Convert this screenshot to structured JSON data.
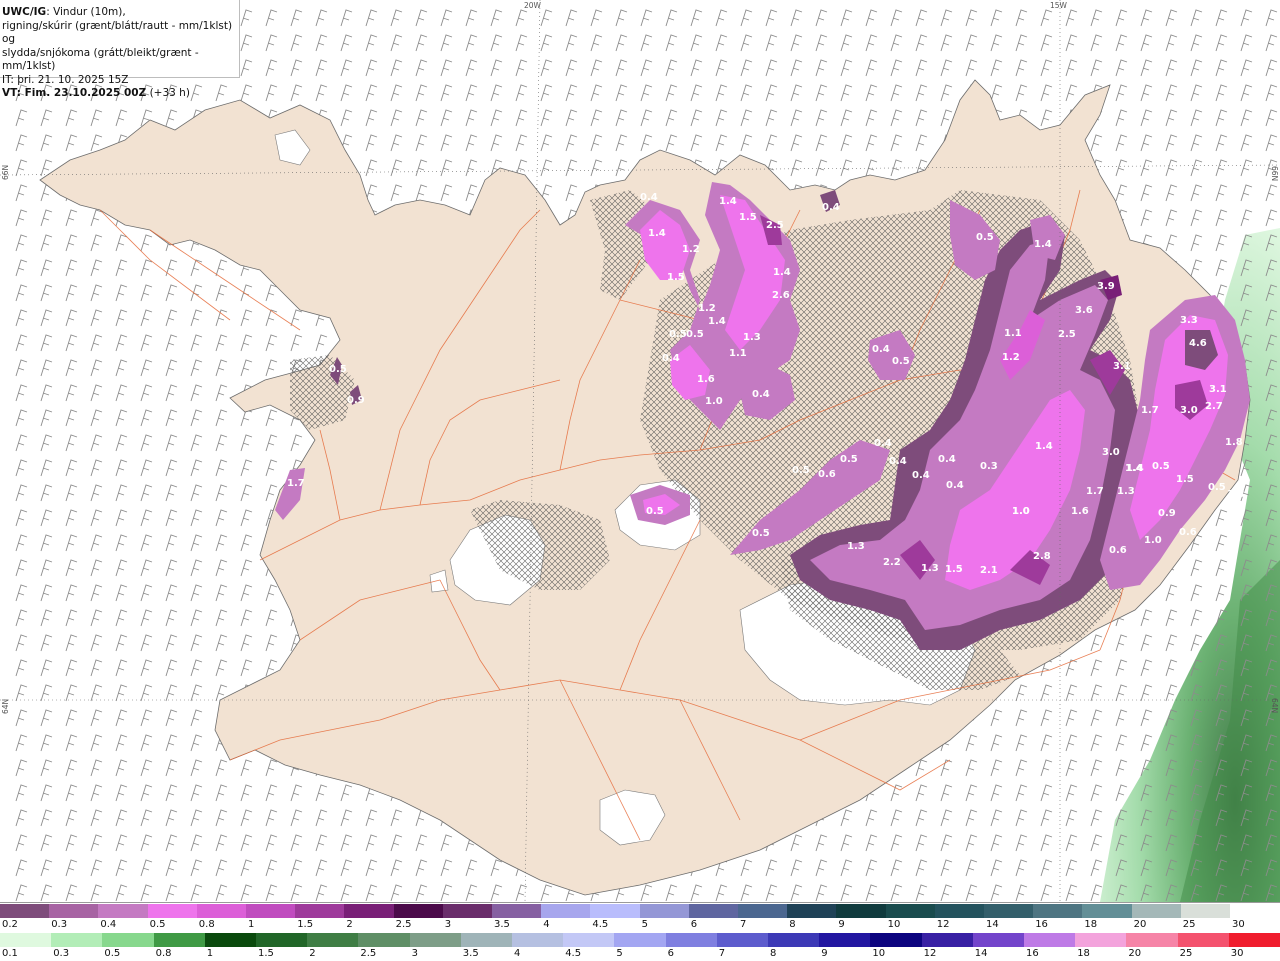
{
  "header": {
    "title_code": "UWC/IG",
    "title_rest": ": Vindur (10m),",
    "line2": "rigning/skúrir (grænt/blátt/rautt - mm/1klst) og",
    "line3": "slydda/snjókoma (grátt/bleikt/grænt - mm/1klst)",
    "it": "IT: þri. 21. 10. 2025 15Z",
    "vt_label": "VT: Fim. 23.10.2025 00Z",
    "vt_offset": "(+33 h)"
  },
  "graticule": {
    "top": [
      "20W",
      "15W"
    ],
    "left": [
      "66N",
      "64N"
    ],
    "right": [
      "66N",
      "64N"
    ]
  },
  "precip_labels": [
    "0.4",
    "1.4",
    "1.5",
    "2.5",
    "0.4",
    "1.4",
    "1.2",
    "0.5",
    "1.4",
    "1.5",
    "1.4",
    "2.6",
    "1.2",
    "1.4",
    "0.5",
    "0.5",
    "1.3",
    "1.1",
    "0.4",
    "1.0",
    "0.4",
    "1.6",
    "0.4",
    "0.5",
    "3.9",
    "3.6",
    "1.1",
    "2.5",
    "1.2",
    "3.1",
    "3.3",
    "4.6",
    "3.1",
    "3.0",
    "2.7",
    "1.7",
    "1.4",
    "1.8",
    "0.4",
    "0.5",
    "0.6",
    "0.5",
    "0.4",
    "0.4",
    "0.4",
    "0.3",
    "0.4",
    "1.4",
    "3.0",
    "1.4",
    "1.0",
    "0.5",
    "1.5",
    "1.7",
    "1.3",
    "1.6",
    "0.5",
    "0.9",
    "0.6",
    "1.0",
    "0.6",
    "0.5",
    "1.3",
    "2.2",
    "1.3",
    "1.5",
    "2.1",
    "2.8",
    "1.0",
    "0.5",
    "1.7",
    "0.5",
    "0.9",
    "3.3"
  ],
  "legend_snow": {
    "labels": [
      "0.2",
      "0.3",
      "0.4",
      "0.5",
      "0.8",
      "1",
      "1.5",
      "2",
      "2.5",
      "3",
      "3.5",
      "4",
      "4.5",
      "5",
      "6",
      "7",
      "8",
      "9",
      "10",
      "12",
      "14",
      "16",
      "18",
      "20",
      "25",
      "30"
    ],
    "colors": [
      "#7e4c7b",
      "#a763a3",
      "#c47ac2",
      "#ee74ec",
      "#dc5fd8",
      "#c04cbf",
      "#9e3a9b",
      "#791f77",
      "#4b0a4a",
      "#6a2d6b",
      "#8660a2",
      "#a7a6ed",
      "#b9bdfc",
      "#9497d6",
      "#5f66a0",
      "#4b6790",
      "#1f4257",
      "#103b3e",
      "#1a4c4e",
      "#24535e",
      "#335f6b",
      "#4e7582",
      "#638f97",
      "#a4b8b8",
      "#d9dfd9",
      "#ffffff"
    ]
  },
  "legend_rain": {
    "labels": [
      "0.1",
      "0.3",
      "0.5",
      "0.8",
      "1",
      "1.5",
      "2",
      "2.5",
      "3",
      "3.5",
      "4",
      "4.5",
      "5",
      "6",
      "7",
      "8",
      "9",
      "10",
      "12",
      "14",
      "16",
      "18",
      "20",
      "25",
      "30"
    ],
    "colors": [
      "#dff9df",
      "#b2edb7",
      "#87d88d",
      "#3f9a45",
      "#0a4a0d",
      "#216628",
      "#3f7e45",
      "#5f8f66",
      "#7e9e88",
      "#9fb4b8",
      "#b5c0e1",
      "#c3c8f6",
      "#a3a6f2",
      "#7f7fe0",
      "#5d5ccd",
      "#3c39b6",
      "#2216a1",
      "#0c047f",
      "#3820a4",
      "#7344cb",
      "#be7ae6",
      "#f3a3dc",
      "#f684a7",
      "#f4526e",
      "#f01d2d"
    ]
  },
  "colors": {
    "land": "#f2e2d2",
    "sea": "#ffffff",
    "road": "#e56b3a",
    "glacier": "#ffffff"
  }
}
